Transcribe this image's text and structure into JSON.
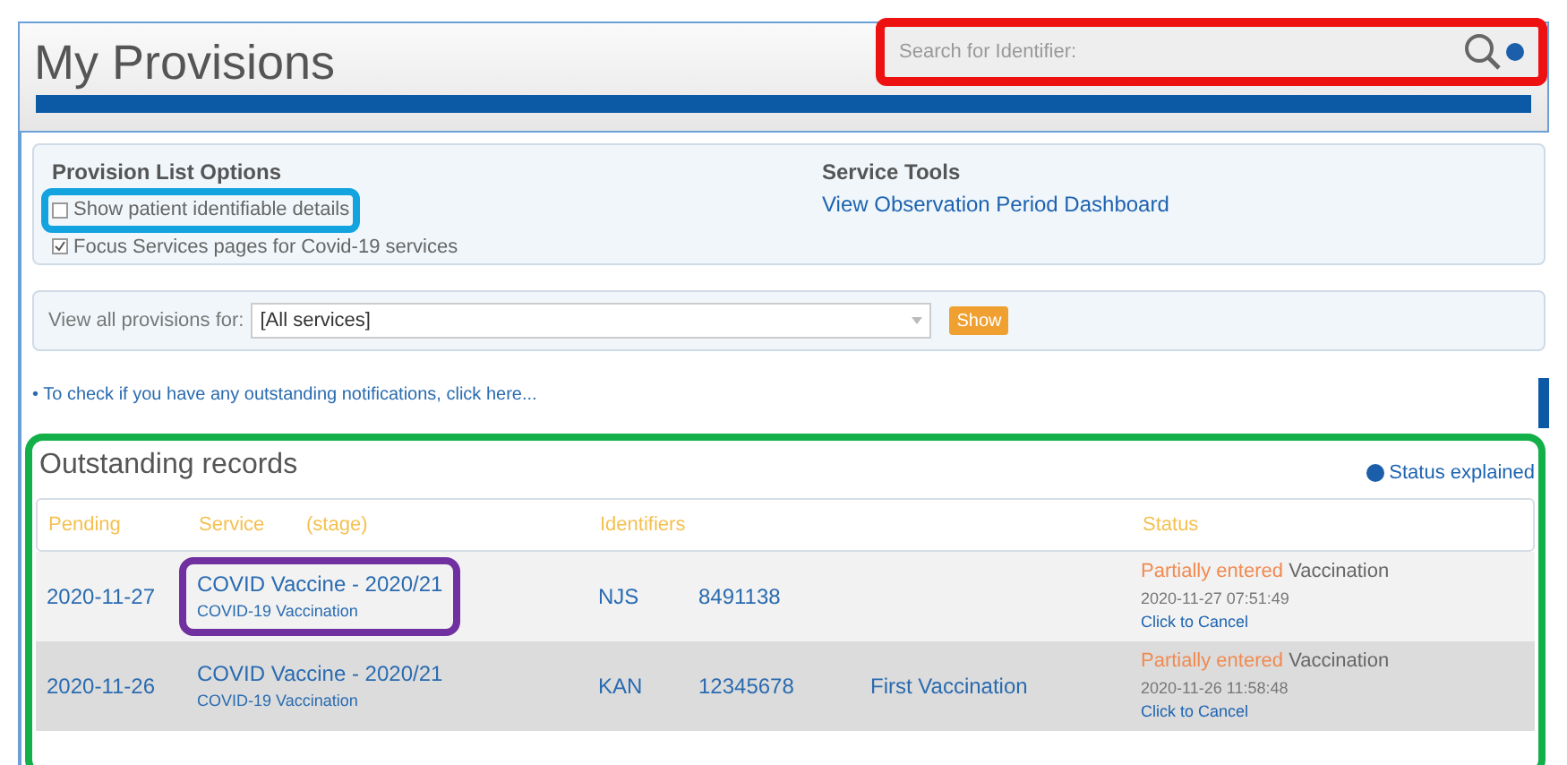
{
  "header": {
    "title": "My Provisions",
    "search": {
      "placeholder": "Search for Identifier:"
    }
  },
  "options": {
    "title": "Provision List Options",
    "checkboxes": [
      {
        "label": "Show patient identifiable details",
        "checked": false
      },
      {
        "label": "Focus Services pages for Covid-19 services",
        "checked": true
      }
    ]
  },
  "service_tools": {
    "title": "Service Tools",
    "link": "View Observation Period Dashboard"
  },
  "filter": {
    "label": "View all provisions for:",
    "value": "[All services]",
    "button": "Show"
  },
  "notification_link": "• To check if you have any outstanding notifications, click here...",
  "outstanding": {
    "title": "Outstanding records",
    "help_link": "Status explained",
    "columns": [
      "Pending",
      "Service",
      "(stage)",
      "Identifiers",
      "Status"
    ],
    "rows": [
      {
        "pending": "2020-11-27",
        "service": "COVID Vaccine - 2020/21",
        "service_sub": "COVID-19 Vaccination",
        "id_type": "NJS",
        "id": "8491138",
        "stage": "",
        "status": "Partially entered",
        "status_detail": "Vaccination",
        "timestamp": "2020-11-27 07:51:49",
        "action": "Click to Cancel",
        "selected": false
      },
      {
        "pending": "2020-11-26",
        "service": "COVID Vaccine - 2020/21",
        "service_sub": "COVID-19 Vaccination",
        "id_type": "KAN",
        "id": "12345678",
        "stage": "First Vaccination",
        "status": "Partially entered",
        "status_detail": "Vaccination",
        "timestamp": "2020-11-26 11:58:48",
        "action": "Click to Cancel",
        "selected": true
      }
    ]
  }
}
